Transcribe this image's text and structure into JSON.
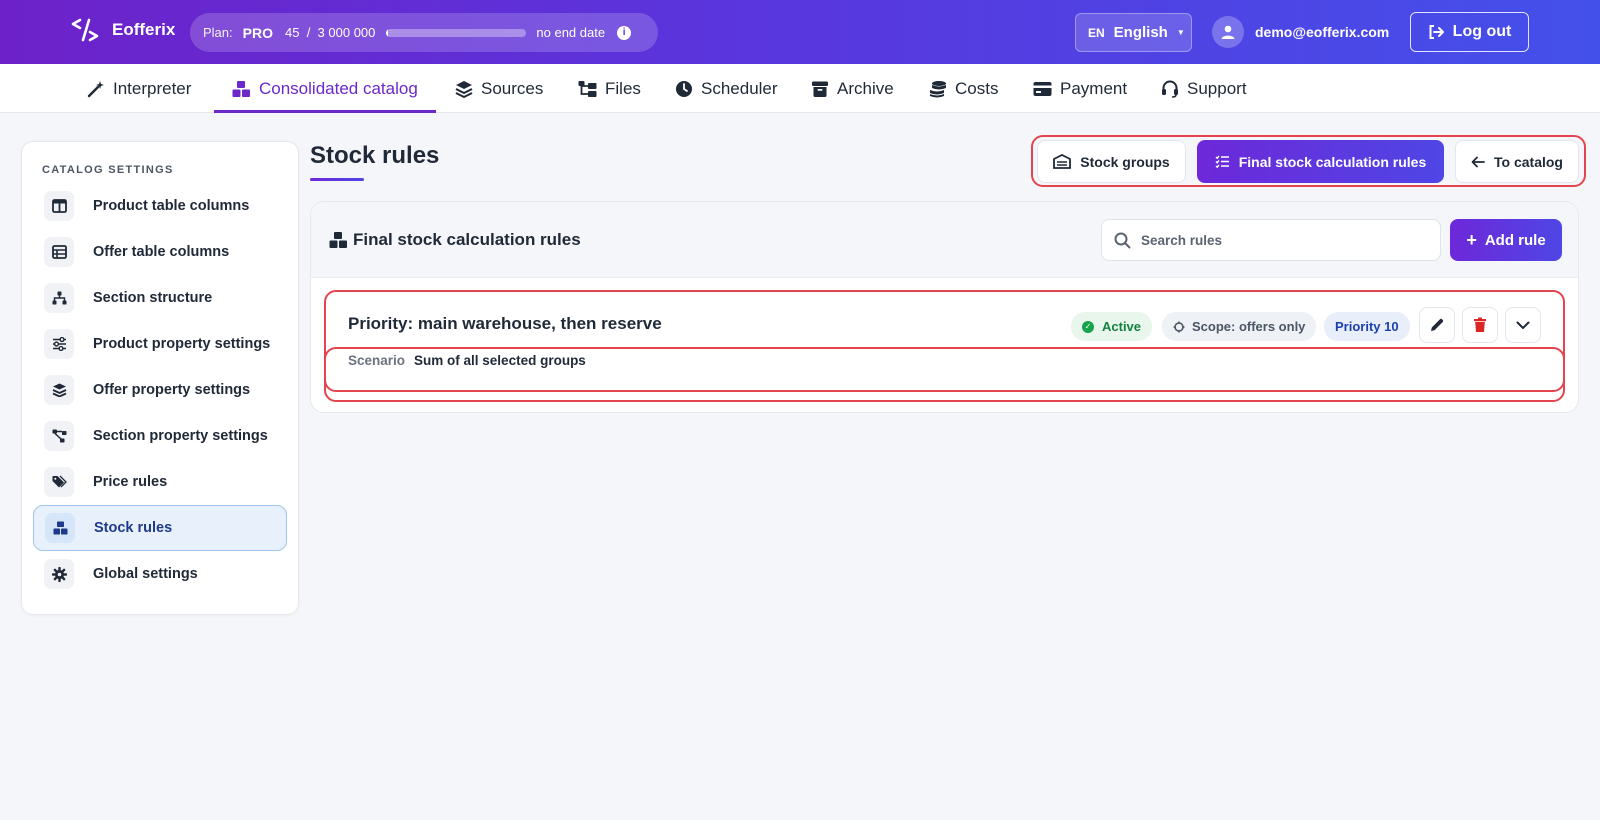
{
  "app": {
    "name": "Eofferix"
  },
  "plan": {
    "label": "Plan:",
    "name": "PRO",
    "used": "45",
    "separator": "/",
    "limit": "3 000 000",
    "usage_fraction": 0.01,
    "end_date": "no end date"
  },
  "language": {
    "code": "EN",
    "name": "English"
  },
  "user": {
    "email": "demo@eofferix.com"
  },
  "logout_label": "Log out",
  "nav": {
    "items": [
      {
        "label": "Interpreter",
        "icon": "magic-wand-icon"
      },
      {
        "label": "Consolidated catalog",
        "icon": "boxes-icon",
        "active": true
      },
      {
        "label": "Sources",
        "icon": "layers-icon"
      },
      {
        "label": "Files",
        "icon": "folder-tree-icon"
      },
      {
        "label": "Scheduler",
        "icon": "clock-icon"
      },
      {
        "label": "Archive",
        "icon": "archive-icon"
      },
      {
        "label": "Costs",
        "icon": "coins-icon"
      },
      {
        "label": "Payment",
        "icon": "credit-card-icon"
      },
      {
        "label": "Support",
        "icon": "headset-icon"
      }
    ]
  },
  "sidebar": {
    "title": "CATALOG SETTINGS",
    "items": [
      {
        "label": "Product table columns",
        "icon": "columns-icon"
      },
      {
        "label": "Offer table columns",
        "icon": "table-icon"
      },
      {
        "label": "Section structure",
        "icon": "sitemap-icon"
      },
      {
        "label": "Product property settings",
        "icon": "sliders-icon"
      },
      {
        "label": "Offer property settings",
        "icon": "layers-icon"
      },
      {
        "label": "Section property settings",
        "icon": "diagram-icon"
      },
      {
        "label": "Price rules",
        "icon": "tags-icon"
      },
      {
        "label": "Stock rules",
        "icon": "boxes-icon",
        "active": true
      },
      {
        "label": "Global settings",
        "icon": "gear-icon"
      }
    ]
  },
  "page": {
    "title": "Stock rules",
    "tabs": {
      "stock_groups": "Stock groups",
      "final_rules": "Final stock calculation rules",
      "to_catalog": "To catalog"
    }
  },
  "card": {
    "title": "Final stock calculation rules",
    "search_placeholder": "Search rules",
    "add_label": "Add rule",
    "rule": {
      "title": "Priority: main warehouse, then reserve",
      "status": "Active",
      "scope": "Scope: offers only",
      "priority": "Priority 10",
      "scenario_label": "Scenario",
      "scenario_value": "Sum of all selected groups"
    }
  },
  "colors": {
    "accent": "#6d28d9",
    "highlight": "#e3454f",
    "active_green": "#15803d",
    "delete_red": "#dc2626"
  }
}
